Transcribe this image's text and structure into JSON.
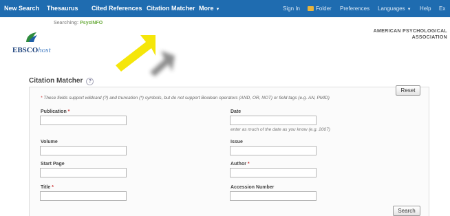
{
  "nav": {
    "left": [
      "New Search",
      "Thesaurus",
      "Cited References",
      "Citation Matcher",
      "More"
    ],
    "right": {
      "sign_in": "Sign In",
      "folder": "Folder",
      "preferences": "Preferences",
      "languages": "Languages",
      "help": "Help",
      "exit": "Ex"
    }
  },
  "header": {
    "logo_main": "EBSCO",
    "logo_suffix": "host",
    "searching_label": "Searching:",
    "database": "PsycINFO",
    "org_line1": "AMERICAN PSYCHOLOGICAL",
    "org_line2": "ASSOCIATION"
  },
  "panel": {
    "title": "Citation Matcher",
    "help": "?",
    "note_prefix": "* ",
    "note": "These fields support wildcard (?) and truncation (*) symbols, but do not support Boolean operators (AND, OR, NOT) or field tags (e.g. AN, PMID)",
    "reset": "Reset",
    "search": "Search"
  },
  "fields": {
    "publication": {
      "label": "Publication",
      "req": " *",
      "value": ""
    },
    "date": {
      "label": "Date",
      "value": "",
      "hint": "enter as much of the date as you know (e.g. 2007)"
    },
    "volume": {
      "label": "Volume",
      "value": ""
    },
    "issue": {
      "label": "Issue",
      "value": ""
    },
    "start_page": {
      "label": "Start Page",
      "value": ""
    },
    "author": {
      "label": "Author",
      "req": " *",
      "value": ""
    },
    "title": {
      "label": "Title",
      "req": " *",
      "value": ""
    },
    "accession": {
      "label": "Accession Number",
      "value": ""
    }
  },
  "colors": {
    "nav_bg": "#1f6cb0",
    "arrow": "#f5e60a",
    "required": "#cc3333",
    "database": "#6aab3c"
  }
}
